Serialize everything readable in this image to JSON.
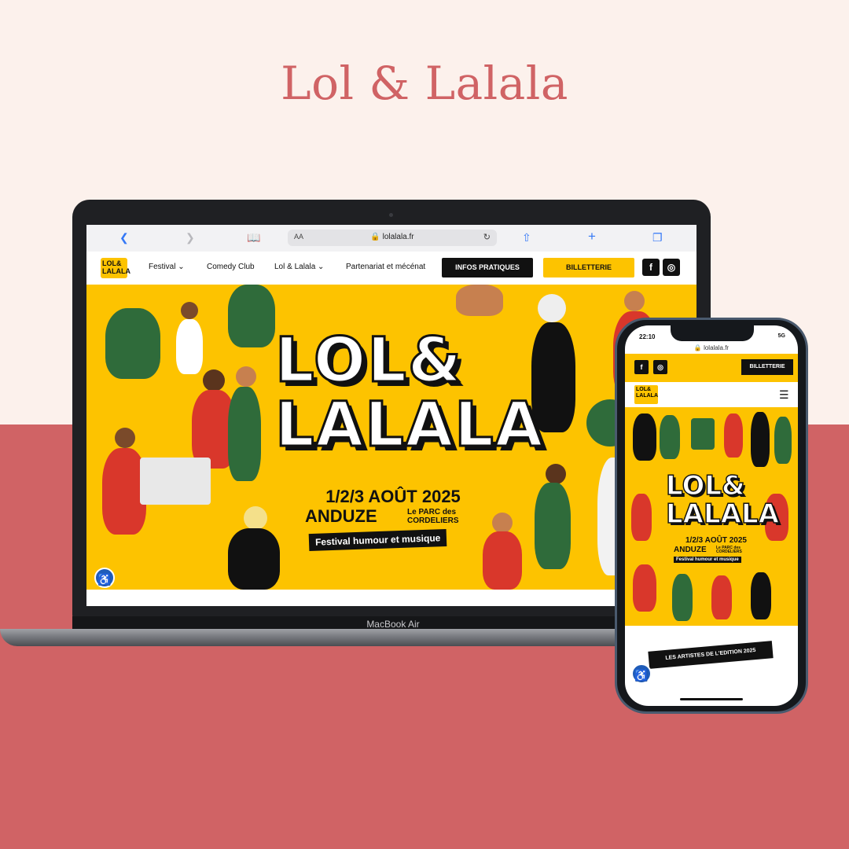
{
  "page": {
    "title": "Lol & Lalala",
    "colors": {
      "bg_top": "#fcf1ec",
      "bg_bottom": "#d06365",
      "title": "#d06365",
      "accent_yellow": "#fdc300",
      "black": "#111111"
    }
  },
  "laptop": {
    "label": "MacBook Air",
    "browser": {
      "back_icon": "chevron-left-icon",
      "forward_icon": "chevron-right-icon",
      "aa": "AA",
      "url": "🔒 lolalala.fr",
      "icons": [
        "book-icon",
        "reload-icon",
        "share-icon",
        "plus-icon",
        "tabs-icon"
      ]
    },
    "nav": {
      "logo": "LOL& LALALA",
      "items": [
        "Festival ⌄",
        "Comedy Club",
        "Lol & Lalala ⌄",
        "Partenariat et mécénat"
      ],
      "info_button": "INFOS PRATIQUES",
      "ticket_button": "BILLETTERIE",
      "facebook": "f",
      "instagram": "◎"
    },
    "hero": {
      "title_line1": "LOL&",
      "title_line2": "LALALA",
      "dates": "1/2/3 AOÛT 2025",
      "city": "ANDUZE",
      "venue": "Le PARC des CORDELIERS",
      "tagline": "Festival humour et musique"
    }
  },
  "phone": {
    "time": "22:10",
    "status": "5G",
    "url": "🔒 lolalala.fr",
    "facebook": "f",
    "instagram": "◎",
    "ticket_button": "BILLETTERIE",
    "logo": "LOL& LALALA",
    "menu_icon": "☰",
    "hero": {
      "title_line1": "LOL&",
      "title_line2": "LALALA",
      "dates": "1/2/3 AOÛT 2025",
      "city": "ANDUZE",
      "venue": "Le PARC des CORDELIERS",
      "tagline": "Festival humour et musique"
    },
    "artists_banner": "LES ARTISTES DE L'EDITION 2025"
  }
}
